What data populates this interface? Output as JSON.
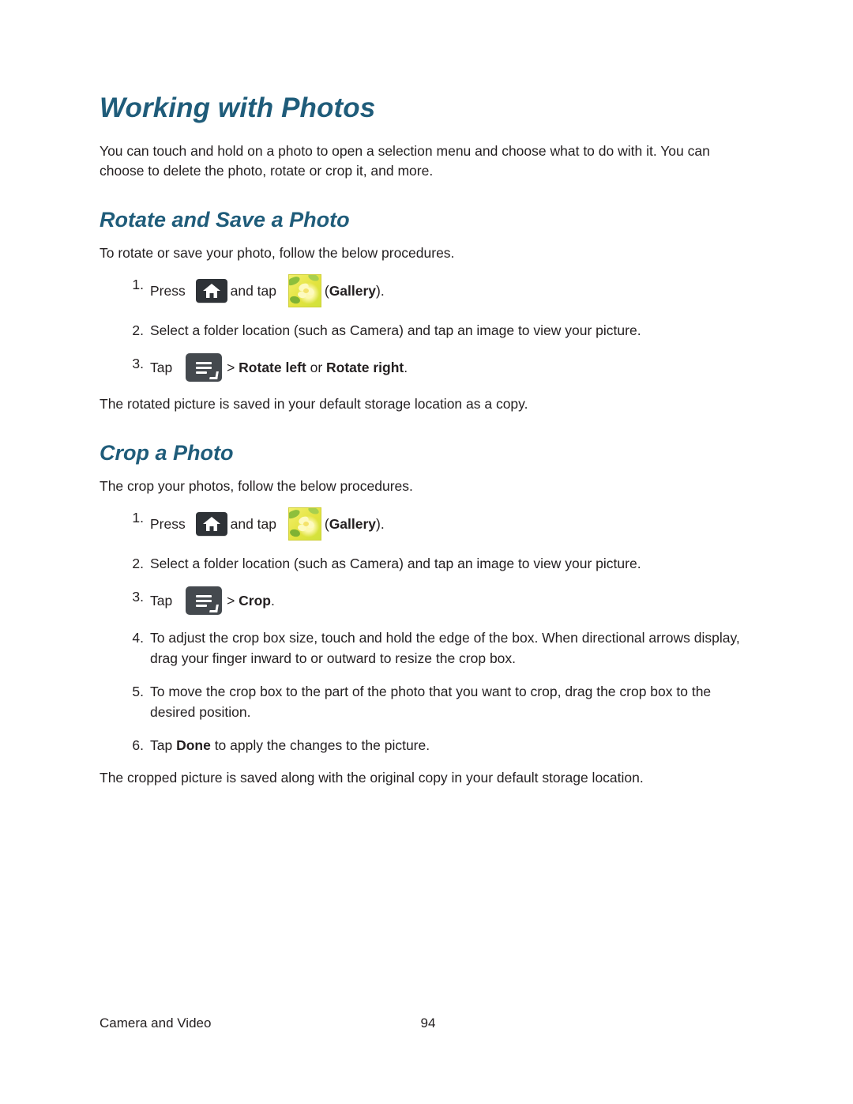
{
  "page": {
    "title": "Working with Photos",
    "intro": "You can touch and hold on a photo to open a selection menu and choose what to do with it. You can choose to delete the photo, rotate or crop it, and more.",
    "footer_left": "Camera and Video",
    "footer_page": "94",
    "heading_color": "#1f5c7a",
    "text_color": "#231f20"
  },
  "sections": [
    {
      "heading": "Rotate and Save a Photo",
      "lead": "To rotate or save your photo, follow the below procedures.",
      "steps": [
        {
          "num": "1.",
          "parts": [
            {
              "type": "text",
              "text": "Press "
            },
            {
              "type": "icon",
              "icon": "home-icon"
            },
            {
              "type": "text",
              "text": "and tap "
            },
            {
              "type": "icon",
              "icon": "gallery-icon"
            },
            {
              "type": "text",
              "text": "("
            },
            {
              "type": "bold",
              "text": "Gallery"
            },
            {
              "type": "text",
              "text": ")."
            }
          ]
        },
        {
          "num": "2.",
          "parts": [
            {
              "type": "text",
              "text": "Select a folder location (such as Camera) and tap an image to view your picture."
            }
          ]
        },
        {
          "num": "3.",
          "parts": [
            {
              "type": "text",
              "text": "Tap "
            },
            {
              "type": "icon",
              "icon": "menu-icon"
            },
            {
              "type": "text",
              "text": "> "
            },
            {
              "type": "bold",
              "text": "Rotate left"
            },
            {
              "type": "text",
              "text": " or "
            },
            {
              "type": "bold",
              "text": "Rotate right"
            },
            {
              "type": "text",
              "text": "."
            }
          ]
        }
      ],
      "note": "The rotated picture is saved in your default storage location as a copy."
    },
    {
      "heading": "Crop a Photo",
      "lead": "The crop your photos, follow the below procedures.",
      "steps": [
        {
          "num": "1.",
          "parts": [
            {
              "type": "text",
              "text": "Press "
            },
            {
              "type": "icon",
              "icon": "home-icon"
            },
            {
              "type": "text",
              "text": "and tap "
            },
            {
              "type": "icon",
              "icon": "gallery-icon"
            },
            {
              "type": "text",
              "text": "("
            },
            {
              "type": "bold",
              "text": "Gallery"
            },
            {
              "type": "text",
              "text": ")."
            }
          ]
        },
        {
          "num": "2.",
          "parts": [
            {
              "type": "text",
              "text": "Select a folder location (such as Camera) and tap an image to view your picture."
            }
          ]
        },
        {
          "num": "3.",
          "parts": [
            {
              "type": "text",
              "text": "Tap "
            },
            {
              "type": "icon",
              "icon": "menu-icon"
            },
            {
              "type": "text",
              "text": "> "
            },
            {
              "type": "bold",
              "text": "Crop"
            },
            {
              "type": "text",
              "text": "."
            }
          ]
        },
        {
          "num": "4.",
          "parts": [
            {
              "type": "text",
              "text": "To adjust the crop box size, touch and hold the edge of the box. When directional arrows display, drag your finger inward to or outward to resize the crop box."
            }
          ]
        },
        {
          "num": "5.",
          "parts": [
            {
              "type": "text",
              "text": "To move the crop box to the part of the photo that you want to crop, drag the crop box to the desired position."
            }
          ]
        },
        {
          "num": "6.",
          "parts": [
            {
              "type": "text",
              "text": "Tap "
            },
            {
              "type": "bold",
              "text": "Done"
            },
            {
              "type": "text",
              "text": " to apply the changes to the picture."
            }
          ]
        }
      ],
      "note": "The cropped picture is saved along with the original copy in your default storage location."
    }
  ]
}
